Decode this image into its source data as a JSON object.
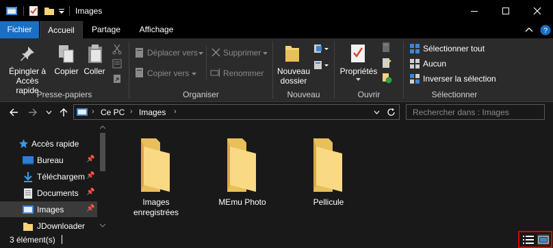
{
  "window": {
    "title": "Images"
  },
  "tabs": {
    "file": "Fichier",
    "home": "Accueil",
    "share": "Partage",
    "view": "Affichage"
  },
  "ribbon": {
    "clipboard": {
      "label": "Presse-papiers",
      "pin": "Épingler à\nAccès rapide",
      "copy": "Copier",
      "paste": "Coller"
    },
    "organize": {
      "label": "Organiser",
      "move": "Déplacer vers",
      "copy_to": "Copier vers",
      "delete": "Supprimer",
      "rename": "Renommer"
    },
    "new": {
      "label": "Nouveau",
      "new_folder": "Nouveau\ndossier"
    },
    "open": {
      "label": "Ouvrir",
      "properties": "Propriétés"
    },
    "select": {
      "label": "Sélectionner",
      "all": "Sélectionner tout",
      "none": "Aucun",
      "invert": "Inverser la sélection"
    }
  },
  "address": {
    "crumbs": [
      "Ce PC",
      "Images"
    ]
  },
  "search": {
    "placeholder": "Rechercher dans : Images"
  },
  "sidebar": {
    "items": [
      {
        "label": "Accès rapide",
        "icon": "star-icon"
      },
      {
        "label": "Bureau",
        "icon": "desktop-icon"
      },
      {
        "label": "Téléchargements",
        "icon": "download-icon"
      },
      {
        "label": "Documents",
        "icon": "documents-icon"
      },
      {
        "label": "Images",
        "icon": "pictures-icon"
      },
      {
        "label": "JDownloader",
        "icon": "folder-icon"
      }
    ]
  },
  "folders": [
    {
      "label": "Images\nenregistrées"
    },
    {
      "label": "MEmu Photo"
    },
    {
      "label": "Pellicule"
    }
  ],
  "status": {
    "count": "3 élément(s)"
  },
  "colors": {
    "accent": "#1a6fc4",
    "folder": "#f6d27a",
    "highlight": "#e00000"
  }
}
